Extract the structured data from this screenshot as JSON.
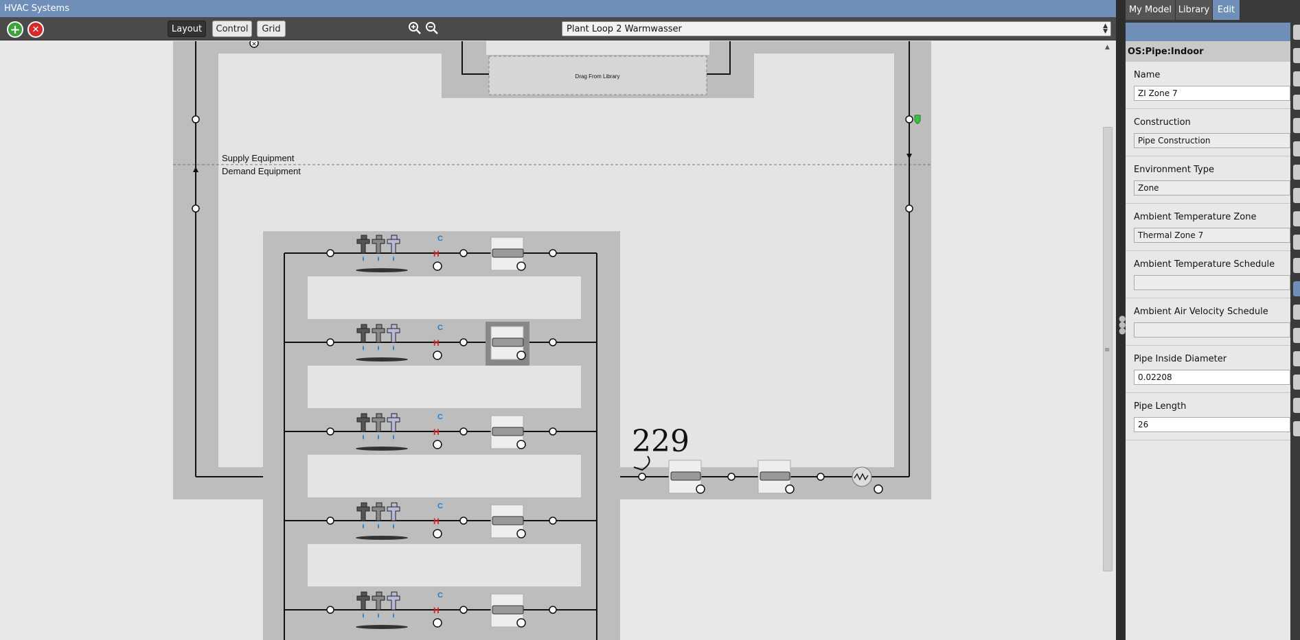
{
  "window": {
    "title": "HVAC Systems"
  },
  "toolbar": {
    "add_label": "+",
    "remove_label": "✕",
    "layout_label": "Layout",
    "control_label": "Control",
    "grid_label": "Grid",
    "zoom_in_icon": "zoom-in-icon",
    "zoom_out_icon": "zoom-out-icon",
    "loop_selected": "Plant Loop 2 Warmwasser"
  },
  "canvas": {
    "drag_placeholder": "Drag From Library",
    "supply_label": "Supply Equipment",
    "demand_label": "Demand Equipment",
    "handwritten_note": "229"
  },
  "tabs": {
    "my_model": "My Model",
    "library": "Library",
    "edit": "Edit"
  },
  "inspector": {
    "object_type": "OS:Pipe:Indoor",
    "fields": [
      {
        "label": "Name",
        "value": "ZI Zone 7",
        "kind": "text"
      },
      {
        "label": "Construction",
        "value": "Pipe Construction",
        "kind": "combo"
      },
      {
        "label": "Environment Type",
        "value": "Zone",
        "kind": "combo"
      },
      {
        "label": "Ambient Temperature Zone",
        "value": "Thermal Zone 7",
        "kind": "combo"
      },
      {
        "label": "Ambient Temperature Schedule",
        "value": "",
        "kind": "combo"
      },
      {
        "label": "Ambient Air Velocity Schedule",
        "value": "",
        "kind": "combo"
      },
      {
        "label": "Pipe Inside Diameter",
        "value": "0.02208",
        "kind": "text"
      },
      {
        "label": "Pipe Length",
        "value": "26",
        "kind": "text"
      }
    ]
  },
  "colors": {
    "accent": "#6f8fb8",
    "add": "#3aa33a",
    "remove": "#d42a2a",
    "cold": "#1e7fd0",
    "hot": "#d42020"
  }
}
